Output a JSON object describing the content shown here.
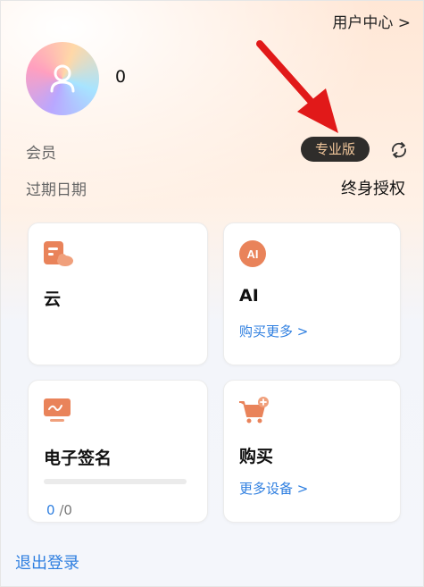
{
  "header": {
    "user_center_label": "用户中心 >"
  },
  "profile": {
    "username": "0",
    "avatar_icon": "user-avatar-icon"
  },
  "membership": {
    "member_label": "会员",
    "member_tier": "专业版",
    "expire_label": "过期日期",
    "expire_value": "终身授权",
    "refresh_icon": "refresh-icon",
    "badge_color": "#2f2d2b",
    "badge_text_color": "#f2c79b"
  },
  "cards": {
    "cloud": {
      "title": "云",
      "icon": "cloud-doc-icon"
    },
    "ai": {
      "title": "AI",
      "link": "购买更多 >",
      "icon": "ai-icon"
    },
    "esign": {
      "title": "电子签名",
      "used": "0",
      "total": "/0",
      "progress": 0,
      "icon": "esign-monitor-icon"
    },
    "buy": {
      "title": "购买",
      "link": "更多设备 >",
      "icon": "cart-plus-icon"
    }
  },
  "footer": {
    "logout_label": "退出登录"
  },
  "colors": {
    "accent": "#2f7fe0",
    "icon_orange": "#e9835a",
    "annotation_red": "#e11919"
  }
}
